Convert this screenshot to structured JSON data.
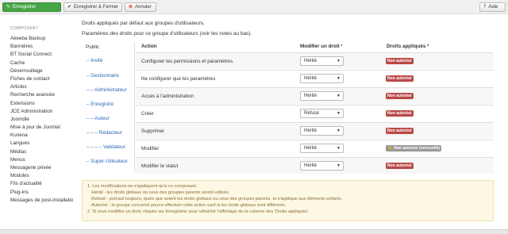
{
  "toolbar": {
    "save": "Enregistrer",
    "save_close": "Enregistrer & Fermer",
    "cancel": "Annuler",
    "help": "Aide"
  },
  "sidebar": {
    "heading": "COMPOSANT",
    "items": [
      "Akeeba Backup",
      "Bannières",
      "BT Social Connect",
      "Cache",
      "Déverrouillage",
      "Fiches de contact",
      "Articles",
      "Recherche avancée",
      "Extensions",
      "JCE Administration",
      "Joomdle",
      "Mise à jour de Joomla!",
      "Kunena",
      "Langues",
      "Médias",
      "Menus",
      "Messagerie privée",
      "Modules",
      "Fils d'actualité",
      "Plug-ins",
      "Messages de post-installation"
    ]
  },
  "intro": {
    "line1": "Droits appliqués par défaut aux groupes d'utilisateurs.",
    "line2": "Paramètres des droits pour ce groupe d'utilisateurs (voir les notes au bas)."
  },
  "groups": {
    "public": "Public",
    "items": [
      "– Invité",
      "– Gestionnaire",
      "– – Administrateur",
      "– Enregistré",
      "– – Auteur",
      "– – – Rédacteur",
      "– – – – Validateur",
      "– Super Utilisateur"
    ]
  },
  "table": {
    "col_action": "Action",
    "col_modify": "Modifier un droit ¹",
    "col_applied": "Droits appliqués ²",
    "rows": [
      {
        "action": "Configurer les permissions et paramètres.",
        "setting": "Hérité",
        "applied": "Non autorisé"
      },
      {
        "action": "Ne configurer que les paramètres",
        "setting": "Hérité",
        "applied": "Non autorisé"
      },
      {
        "action": "Accès à l'administration",
        "setting": "Hérité",
        "applied": "Non autorisé"
      },
      {
        "action": "Créer",
        "setting": "Refusé",
        "applied": "Non autorisé"
      },
      {
        "action": "Supprimer",
        "setting": "Hérité",
        "applied": "Non autorisé"
      },
      {
        "action": "Modifier",
        "setting": "Hérité",
        "applied": "Non autorisé (verrouillé)"
      },
      {
        "action": "Modifier le statut",
        "setting": "Hérité",
        "applied": "Non autorisé"
      }
    ]
  },
  "notes": {
    "n1": "1. Les modifications ne s'appliquent qu'à ce composant.",
    "herite_label": "Hérité",
    "herite_text": " - les droits globaux ou ceux des groupes parents seront utilisés.",
    "refuse_label": "Refusé",
    "refuse_text": " - prévaut toujours, quels que soient les droits globaux ou ceux des groupes parents, et s'applique aux éléments enfants.",
    "autorise_label": "Autorisé",
    "autorise_text": " - le groupe concerné pourra effectuer cette action sauf si les droits globaux sont différents.",
    "n2_a": "2. Si vous modifiez un droit, cliquez sur ",
    "n2_em": "Enregistrer",
    "n2_b": " pour rafraîchir l'affichage de la colonne des 'Droits appliqués'."
  }
}
